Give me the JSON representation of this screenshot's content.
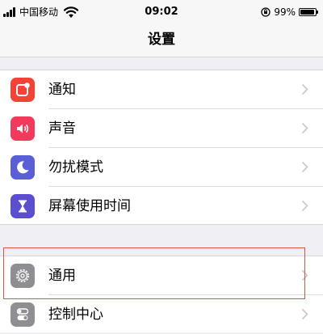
{
  "status_bar": {
    "carrier": "中国移动",
    "time": "09:02",
    "battery": "99%"
  },
  "nav": {
    "title": "设置"
  },
  "groups": [
    {
      "items": [
        {
          "label": "通知",
          "icon": "notifications-icon",
          "color": "#f44336"
        },
        {
          "label": "声音",
          "icon": "sounds-icon",
          "color": "#f23a5c"
        },
        {
          "label": "勿扰模式",
          "icon": "do-not-disturb-icon",
          "color": "#5b5fd6"
        },
        {
          "label": "屏幕使用时间",
          "icon": "screen-time-icon",
          "color": "#5b4fcf"
        }
      ]
    },
    {
      "items": [
        {
          "label": "通用",
          "icon": "gear-icon",
          "color": "#8e8e93"
        },
        {
          "label": "控制中心",
          "icon": "control-center-icon",
          "color": "#8e8e93"
        }
      ]
    }
  ],
  "highlight_color": "#d9534f"
}
